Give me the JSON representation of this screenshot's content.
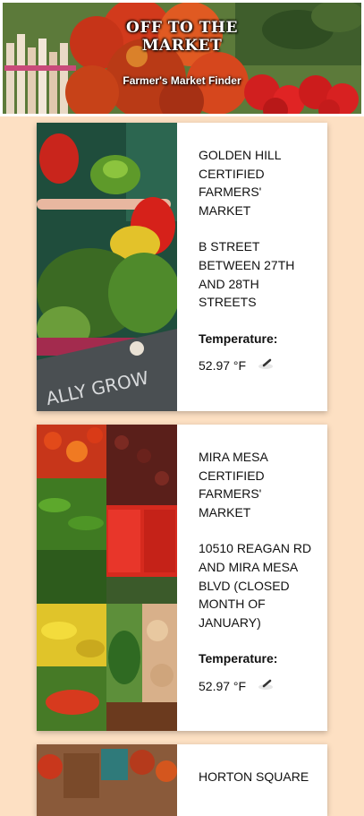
{
  "header": {
    "title_line1": "OFF TO THE",
    "title_line2": "MARKET",
    "subtitle": "Farmer's Market Finder"
  },
  "markets": [
    {
      "name": "GOLDEN HILL CERTIFIED FARMERS' MARKET",
      "address": "B STREET BETWEEN 27TH AND 28TH STREETS",
      "temp_label": "Temperature:",
      "temp_value": "52.97 °F",
      "weather_icon": "cloud-wind-icon",
      "image": "produce-basket-chalkboard-image"
    },
    {
      "name": "MIRA MESA CERTIFIED FARMERS' MARKET",
      "address": "10510 REAGAN RD AND MIRA MESA BLVD (CLOSED MONTH OF JANUARY)",
      "temp_label": "Temperature:",
      "temp_value": "52.97 °F",
      "weather_icon": "cloud-wind-icon",
      "image": "vegetable-stall-image"
    },
    {
      "name": "HORTON SQUARE",
      "image": "market-baskets-image"
    }
  ]
}
